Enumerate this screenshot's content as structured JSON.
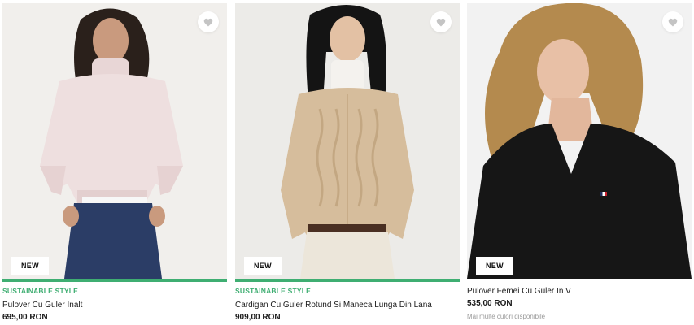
{
  "products": [
    {
      "tag": "SUSTAINABLE STYLE",
      "name": "Pulover Cu Guler Inalt",
      "price": "695,00 RON",
      "badge": "NEW",
      "bg": "#f1efec",
      "garment": "#eedfdf",
      "pants": "#2b3d66"
    },
    {
      "tag": "SUSTAINABLE STYLE",
      "name": "Cardigan Cu Guler Rotund Si Maneca Lunga Din Lana",
      "price": "909,00 RON",
      "badge": "NEW",
      "bg": "#ecebe8",
      "garment": "#d6bd9c",
      "pants": "#ece6da"
    },
    {
      "tag": "",
      "name": "Pulover Femei Cu Guler In V",
      "price": "535,00 RON",
      "badge": "NEW",
      "more_colors": "Mai multe culori disponibile",
      "bg": "#f2f2f2",
      "garment": "#161616",
      "hair": "#b48a4e"
    }
  ],
  "colors": {
    "accent": "#3fae72",
    "heart": "#c4c4c4"
  },
  "icons": {
    "wishlist": "heart-icon"
  }
}
